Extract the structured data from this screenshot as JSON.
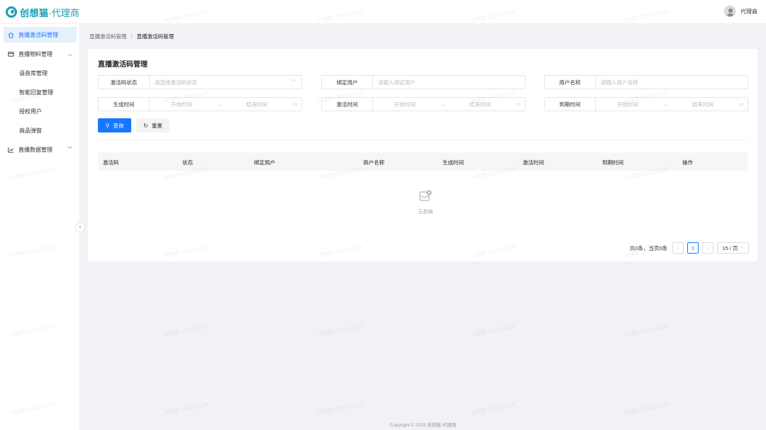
{
  "app": {
    "logo_brand": "创想猫",
    "logo_suffix": "·代理商",
    "user_name": "代理商"
  },
  "sidebar": {
    "items": [
      {
        "label": "直播激活码管理",
        "icon": "home-icon",
        "active": true
      },
      {
        "label": "直播物料管理",
        "icon": "mail-icon",
        "expanded": true
      },
      {
        "label": "直播数据管理",
        "icon": "chart-icon",
        "expanded": false
      }
    ],
    "sub_items": [
      "语音库管理",
      "智能回复管理",
      "授权用户",
      "商品弹窗"
    ]
  },
  "breadcrumb": {
    "parent": "直播激活码管理",
    "separator": "/",
    "current": "直播激活码管理"
  },
  "page": {
    "title": "直播激活码管理"
  },
  "filters": {
    "status": {
      "label": "激活码状态",
      "placeholder": "请选择激活码状态"
    },
    "bind_user": {
      "label": "绑定用户",
      "placeholder": "请输入绑定用户"
    },
    "merchant": {
      "label": "商户名称",
      "placeholder": "请输入商户名称"
    },
    "created": {
      "label": "生成时间",
      "start": "开始时间",
      "end": "结束时间"
    },
    "activated": {
      "label": "激活时间",
      "start": "开始时间",
      "end": "结束时间"
    },
    "expires": {
      "label": "到期时间",
      "start": "开始时间",
      "end": "结束时间"
    }
  },
  "buttons": {
    "search": "查询",
    "reset": "重置"
  },
  "table": {
    "columns": [
      "激活码",
      "状态",
      "绑定用户",
      "商户名称",
      "生成时间",
      "激活时间",
      "到期时间",
      "操作"
    ],
    "rows": [],
    "empty_text": "无数据"
  },
  "pagination": {
    "summary": "共0条，当页0条",
    "current_page": "1",
    "page_size": "15 / 页"
  },
  "footer": {
    "copyright": "Copyright © 2023 创想猫-代理商"
  },
  "watermark": "代理商 13511111114",
  "colors": {
    "primary": "#1677ff",
    "brand": "#1aa0b5",
    "active_bg": "#e6f0fb"
  }
}
